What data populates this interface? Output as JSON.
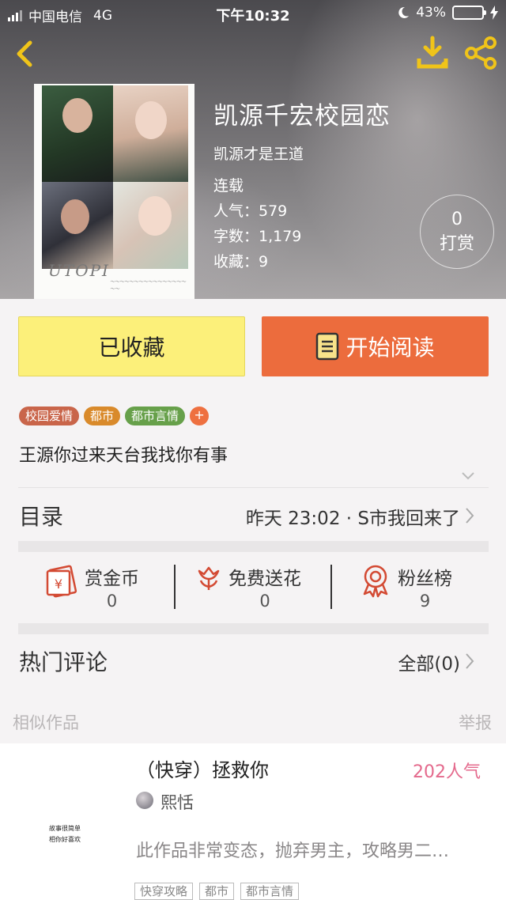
{
  "status_bar": {
    "carrier": "中国电信",
    "network": "4G",
    "time": "下午10:32",
    "battery": "43%",
    "battery_level": 0.43
  },
  "book": {
    "title": "凯源千宏校园恋",
    "author": "凯源才是王道",
    "status": "连载",
    "popularity": "人气：579",
    "word_count": "字数：1,179",
    "favorites": "收藏：9",
    "cover_lettering": "UTOPI",
    "reward": {
      "count": "0",
      "label": "打赏"
    }
  },
  "actions": {
    "favorited_label": "已收藏",
    "read_label": "开始阅读"
  },
  "tags": [
    {
      "label": "校园爱情",
      "color": "#c9654a"
    },
    {
      "label": "都市",
      "color": "#d98a2b"
    },
    {
      "label": "都市言情",
      "color": "#67a04a"
    }
  ],
  "tag_add_label": "+",
  "description": "王源你过来天台我找你有事",
  "catalog": {
    "label": "目录",
    "latest": "昨天 23:02 · S市我回来了"
  },
  "stats": [
    {
      "label": "赏金币",
      "value": "0",
      "icon": "coin-envelope-icon"
    },
    {
      "label": "免费送花",
      "value": "0",
      "icon": "flower-icon"
    },
    {
      "label": "粉丝榜",
      "value": "9",
      "icon": "medal-icon"
    }
  ],
  "comments": {
    "label": "热门评论",
    "all_label": "全部(0)"
  },
  "similar": {
    "label": "相似作品",
    "report_label": "举报"
  },
  "similar_work": {
    "title": "（快穿）拯救你",
    "popularity": "202人气",
    "author": "熙恬",
    "description": "此作品非常变态，抛弃男主，攻略男二…",
    "cover_lines": [
      "故事很简单",
      "相你好喜欢"
    ],
    "tags": [
      "快穿攻略",
      "都市",
      "都市言情"
    ]
  },
  "colors": {
    "favorite_button": "#fcf07a",
    "read_button": "#ec6c3d",
    "accent_icon": "#f0c419",
    "popularity_pink": "#e4698c"
  }
}
